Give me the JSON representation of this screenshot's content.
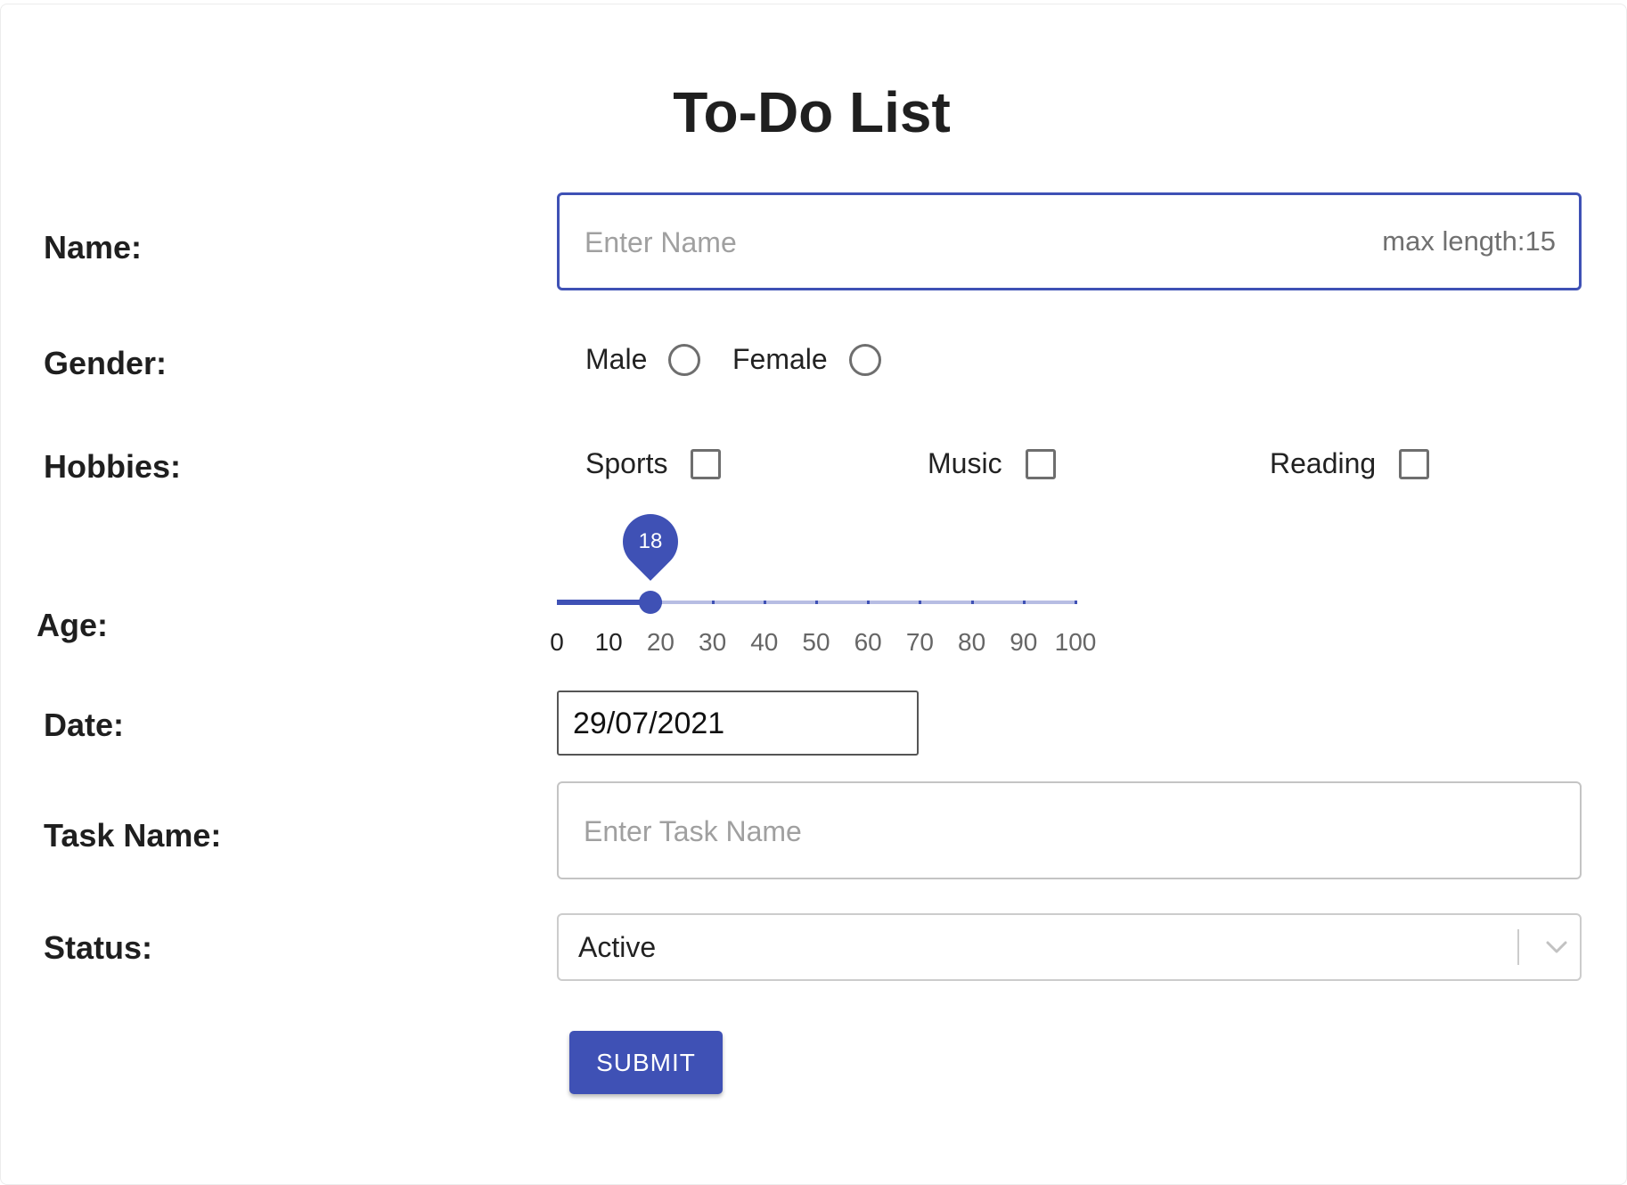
{
  "form": {
    "title": "To-Do List",
    "accent_color": "#3f51b5",
    "name": {
      "label": "Name:",
      "placeholder": "Enter Name",
      "value": "",
      "helper": "max length:15"
    },
    "gender": {
      "label": "Gender:",
      "options": [
        "Male",
        "Female"
      ],
      "selected": null
    },
    "hobbies": {
      "label": "Hobbies:",
      "options": [
        "Sports",
        "Music",
        "Reading"
      ],
      "checked": []
    },
    "age": {
      "label": "Age:",
      "value": 18,
      "value_label": "18",
      "min": 0,
      "max": 100,
      "step": 10,
      "marks": [
        "0",
        "10",
        "20",
        "30",
        "40",
        "50",
        "60",
        "70",
        "80",
        "90",
        "100"
      ]
    },
    "date": {
      "label": "Date:",
      "value": "29/07/2021"
    },
    "task_name": {
      "label": "Task Name:",
      "placeholder": "Enter Task Name",
      "value": ""
    },
    "status": {
      "label": "Status:",
      "value": "Active"
    },
    "submit_label": "SUBMIT"
  }
}
